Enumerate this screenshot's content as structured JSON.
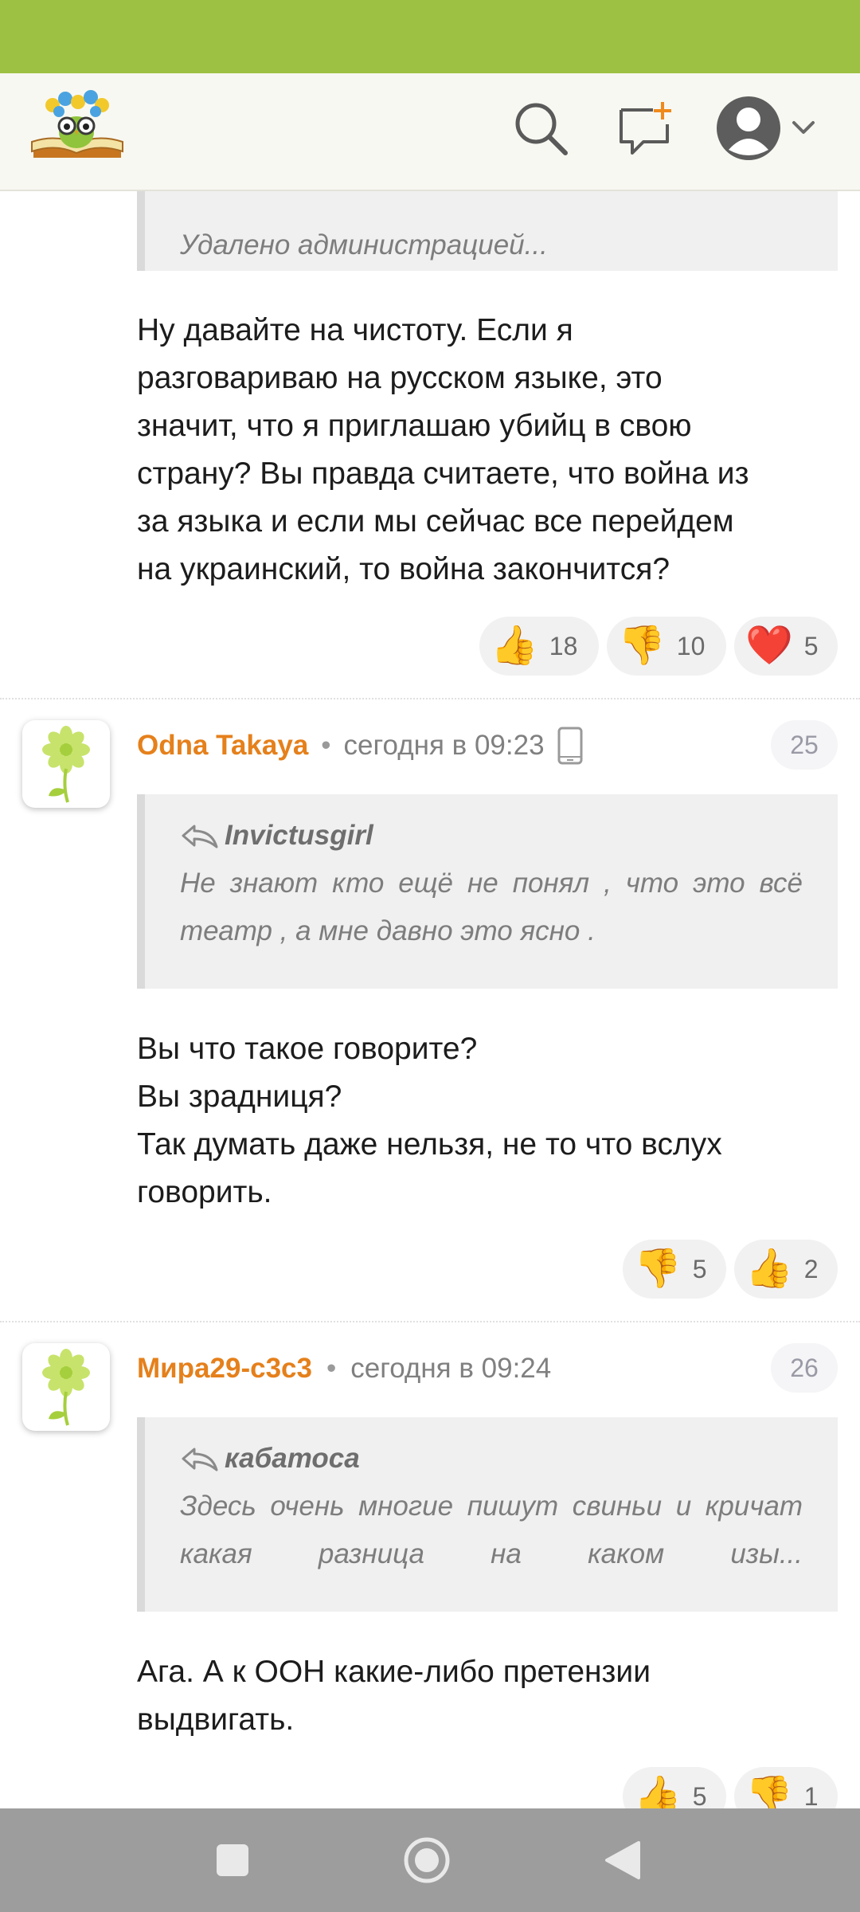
{
  "comments": [
    {
      "quote_text": "Удалено администрацией...",
      "body_lines": [
        "Ну давайте на чистоту. Если я",
        "разговариваю на русском языке, это",
        "значит, что я приглашаю убийц в свою",
        "страну? Вы правда считаете, что война из",
        "за языка и если мы сейчас все перейдем",
        "на украинский, то война закончится?"
      ],
      "reactions": [
        {
          "icon": "thumbs-up-icon",
          "emoji": "👍",
          "count": "18"
        },
        {
          "icon": "thumbs-down-icon",
          "emoji": "👎",
          "count": "10"
        },
        {
          "icon": "heart-icon",
          "emoji": "❤️",
          "count": "5"
        }
      ]
    },
    {
      "author": "Odna Takaya",
      "time": "сегодня в 09:23",
      "number": "25",
      "quote_author": "Invictusgirl",
      "quote_lines": [
        "Не знают кто ещё не понял , что это всё",
        "театр , а мне давно это ясно ."
      ],
      "body_lines": [
        "Вы что такое говорите?",
        "Вы зрадниця?",
        "Так думать даже нельзя, не то что вслух",
        "говорить."
      ],
      "reactions": [
        {
          "icon": "thumbs-down-icon",
          "emoji": "👎",
          "count": "5"
        },
        {
          "icon": "thumbs-up-icon",
          "emoji": "👍",
          "count": "2"
        }
      ]
    },
    {
      "author": "Мира29-с3с3",
      "time": "сегодня в 09:24",
      "number": "26",
      "quote_author": "кабатоса",
      "quote_lines": [
        "Здесь очень многие пишут свиньи и кричат",
        "какая разница на каком изы..."
      ],
      "body_lines": [
        "Ага. А к ООН какие-либо претензии",
        "выдвигать."
      ],
      "reactions": [
        {
          "icon": "thumbs-up-icon",
          "emoji": "👍",
          "count": "5"
        },
        {
          "icon": "thumbs-down-icon",
          "emoji": "👎",
          "count": "1"
        }
      ]
    }
  ],
  "colors": {
    "status_bar": "#9dc143",
    "author": "#e5801b",
    "nav_bar": "#9d9d9d"
  }
}
